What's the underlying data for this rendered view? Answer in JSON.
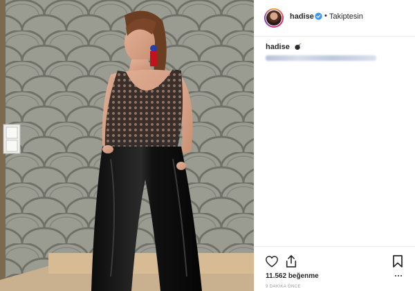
{
  "header": {
    "username": "hadise",
    "separator": "•",
    "follow_status": "Takiptesin"
  },
  "caption": {
    "username": "hadise",
    "emoji_icon": "bomb-icon"
  },
  "post": {
    "likes": "11.562 beğenme",
    "time_ago": "9 DAKİKA ÖNCE"
  },
  "icons": {
    "verified": "verified-badge-icon",
    "like": "heart-icon",
    "share": "share-icon",
    "save": "bookmark-icon",
    "more": "more-options-icon"
  },
  "colors": {
    "verified_blue": "#3897f0",
    "text": "#262626",
    "muted": "#999999"
  }
}
